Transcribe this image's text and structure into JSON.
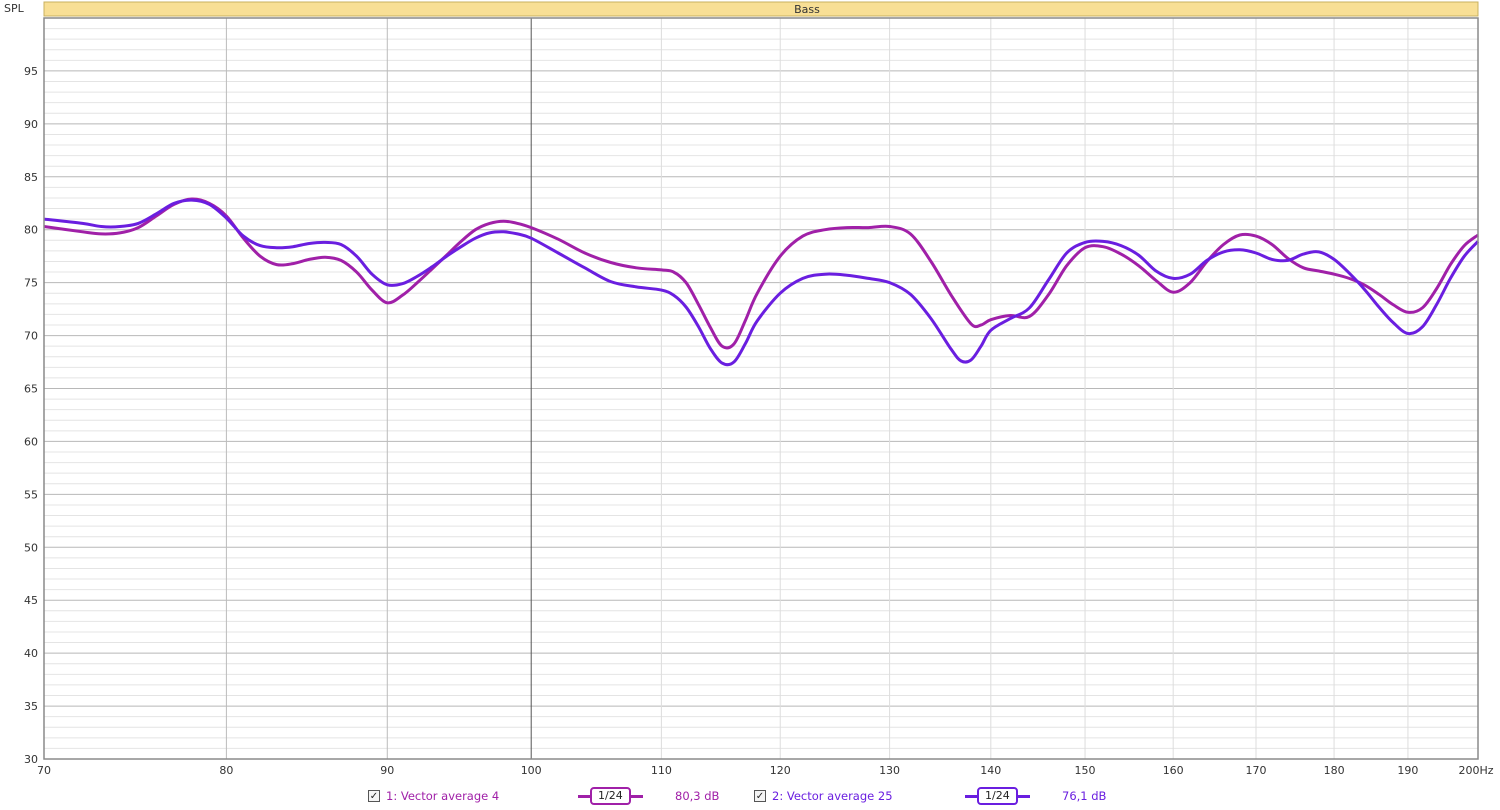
{
  "chart_data": {
    "type": "line",
    "title": "Bass",
    "ylabel": "SPL",
    "xunit": "Hz",
    "xscale": "log",
    "xlim": [
      70,
      200
    ],
    "ylim": [
      30,
      100
    ],
    "x_ticks": [
      "70",
      "80",
      "90",
      "100",
      "110",
      "120",
      "130",
      "140",
      "150",
      "160",
      "170",
      "180",
      "190",
      "200Hz"
    ],
    "y_ticks": [
      "30",
      "35",
      "40",
      "45",
      "50",
      "55",
      "60",
      "65",
      "70",
      "75",
      "80",
      "85",
      "90",
      "95"
    ],
    "grid": true,
    "series": [
      {
        "name": "1: Vector average 4",
        "color": "#a020a8",
        "points": [
          [
            70,
            80.3
          ],
          [
            72,
            79.8
          ],
          [
            73,
            79.6
          ],
          [
            74,
            79.7
          ],
          [
            75,
            80.2
          ],
          [
            76,
            81.3
          ],
          [
            77,
            82.4
          ],
          [
            78,
            82.9
          ],
          [
            79,
            82.5
          ],
          [
            80,
            81.3
          ],
          [
            81,
            79.2
          ],
          [
            82,
            77.5
          ],
          [
            83,
            76.7
          ],
          [
            84,
            76.8
          ],
          [
            85,
            77.2
          ],
          [
            86,
            77.4
          ],
          [
            87,
            77.1
          ],
          [
            88,
            76.0
          ],
          [
            89,
            74.3
          ],
          [
            90,
            73.1
          ],
          [
            91,
            73.8
          ],
          [
            92,
            75.0
          ],
          [
            93,
            76.3
          ],
          [
            94,
            77.6
          ],
          [
            95,
            78.9
          ],
          [
            96,
            80.0
          ],
          [
            97,
            80.6
          ],
          [
            98,
            80.8
          ],
          [
            99,
            80.6
          ],
          [
            100,
            80.2
          ],
          [
            102,
            79.1
          ],
          [
            104,
            77.8
          ],
          [
            106,
            76.9
          ],
          [
            108,
            76.4
          ],
          [
            110,
            76.2
          ],
          [
            111,
            76.0
          ],
          [
            112,
            75.0
          ],
          [
            113,
            73.0
          ],
          [
            114,
            70.8
          ],
          [
            115,
            69.0
          ],
          [
            116,
            69.2
          ],
          [
            117,
            71.5
          ],
          [
            118,
            74.0
          ],
          [
            120,
            77.5
          ],
          [
            122,
            79.4
          ],
          [
            124,
            80.0
          ],
          [
            126,
            80.2
          ],
          [
            128,
            80.2
          ],
          [
            130,
            80.3
          ],
          [
            132,
            79.6
          ],
          [
            134,
            77.0
          ],
          [
            136,
            73.8
          ],
          [
            138,
            71.1
          ],
          [
            139,
            71.0
          ],
          [
            140,
            71.5
          ],
          [
            142,
            71.9
          ],
          [
            144,
            71.8
          ],
          [
            146,
            73.8
          ],
          [
            148,
            76.6
          ],
          [
            150,
            78.3
          ],
          [
            152,
            78.4
          ],
          [
            154,
            77.7
          ],
          [
            156,
            76.6
          ],
          [
            158,
            75.2
          ],
          [
            160,
            74.1
          ],
          [
            162,
            75.0
          ],
          [
            164,
            77.0
          ],
          [
            166,
            78.6
          ],
          [
            168,
            79.5
          ],
          [
            170,
            79.4
          ],
          [
            172,
            78.6
          ],
          [
            174,
            77.3
          ],
          [
            176,
            76.4
          ],
          [
            178,
            76.1
          ],
          [
            180,
            75.8
          ],
          [
            182,
            75.4
          ],
          [
            184,
            74.8
          ],
          [
            186,
            73.9
          ],
          [
            188,
            72.9
          ],
          [
            190,
            72.2
          ],
          [
            192,
            72.6
          ],
          [
            194,
            74.4
          ],
          [
            196,
            76.7
          ],
          [
            198,
            78.5
          ],
          [
            200,
            79.5
          ]
        ]
      },
      {
        "name": "2: Vector average 25",
        "color": "#6a1ee0",
        "points": [
          [
            70,
            81.0
          ],
          [
            72,
            80.6
          ],
          [
            73,
            80.3
          ],
          [
            74,
            80.3
          ],
          [
            75,
            80.6
          ],
          [
            76,
            81.5
          ],
          [
            77,
            82.5
          ],
          [
            78,
            82.8
          ],
          [
            79,
            82.4
          ],
          [
            80,
            81.1
          ],
          [
            81,
            79.4
          ],
          [
            82,
            78.5
          ],
          [
            83,
            78.3
          ],
          [
            84,
            78.4
          ],
          [
            85,
            78.7
          ],
          [
            86,
            78.8
          ],
          [
            87,
            78.6
          ],
          [
            88,
            77.5
          ],
          [
            89,
            75.8
          ],
          [
            90,
            74.8
          ],
          [
            91,
            74.9
          ],
          [
            92,
            75.6
          ],
          [
            93,
            76.5
          ],
          [
            94,
            77.5
          ],
          [
            95,
            78.4
          ],
          [
            96,
            79.2
          ],
          [
            97,
            79.7
          ],
          [
            98,
            79.8
          ],
          [
            99,
            79.6
          ],
          [
            100,
            79.2
          ],
          [
            102,
            77.8
          ],
          [
            104,
            76.4
          ],
          [
            106,
            75.1
          ],
          [
            108,
            74.6
          ],
          [
            110,
            74.3
          ],
          [
            111,
            73.8
          ],
          [
            112,
            72.7
          ],
          [
            113,
            70.9
          ],
          [
            114,
            68.8
          ],
          [
            115,
            67.4
          ],
          [
            116,
            67.5
          ],
          [
            117,
            69.3
          ],
          [
            118,
            71.4
          ],
          [
            120,
            74.0
          ],
          [
            122,
            75.4
          ],
          [
            124,
            75.8
          ],
          [
            126,
            75.7
          ],
          [
            128,
            75.4
          ],
          [
            130,
            75.0
          ],
          [
            132,
            73.9
          ],
          [
            134,
            71.6
          ],
          [
            136,
            68.7
          ],
          [
            137,
            67.6
          ],
          [
            138,
            67.7
          ],
          [
            139,
            69.0
          ],
          [
            140,
            70.5
          ],
          [
            142,
            71.6
          ],
          [
            144,
            72.6
          ],
          [
            146,
            75.2
          ],
          [
            148,
            77.8
          ],
          [
            150,
            78.8
          ],
          [
            152,
            78.9
          ],
          [
            154,
            78.5
          ],
          [
            156,
            77.6
          ],
          [
            158,
            76.1
          ],
          [
            160,
            75.4
          ],
          [
            162,
            75.8
          ],
          [
            164,
            77.1
          ],
          [
            166,
            77.9
          ],
          [
            168,
            78.1
          ],
          [
            170,
            77.8
          ],
          [
            172,
            77.2
          ],
          [
            174,
            77.1
          ],
          [
            176,
            77.7
          ],
          [
            178,
            77.9
          ],
          [
            180,
            77.2
          ],
          [
            182,
            75.9
          ],
          [
            184,
            74.4
          ],
          [
            186,
            72.7
          ],
          [
            188,
            71.2
          ],
          [
            190,
            70.2
          ],
          [
            192,
            70.8
          ],
          [
            194,
            72.9
          ],
          [
            196,
            75.4
          ],
          [
            198,
            77.5
          ],
          [
            200,
            78.9
          ]
        ]
      }
    ]
  },
  "legend": [
    {
      "checked": "✓",
      "label": "1: Vector average 4",
      "smoothing": "1/24",
      "value": "80,3 dB",
      "color": "#a020a8"
    },
    {
      "checked": "✓",
      "label": "2: Vector average 25",
      "smoothing": "1/24",
      "value": "76,1 dB",
      "color": "#6a1ee0"
    }
  ],
  "colors": {
    "title_bar": "#f8df95",
    "grid_major": "#b8b8b8",
    "grid_minor": "#e4e4e4",
    "frame": "#8a8a8a"
  }
}
